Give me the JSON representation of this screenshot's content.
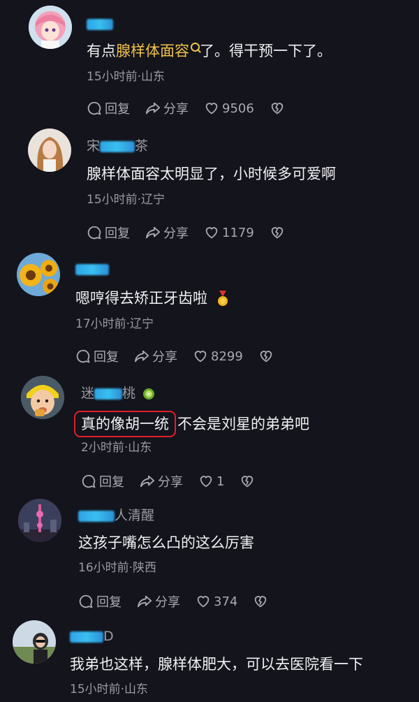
{
  "actions": {
    "reply_label": "回复",
    "share_label": "分享"
  },
  "comments": [
    {
      "username_suffix": "",
      "text_before": "有点",
      "text_highlight": "腺样体面容",
      "text_after": "了。得干预一下了。",
      "meta": "15小时前·山东",
      "likes": "9506"
    },
    {
      "username_prefix": "宋",
      "username_suffix": "茶",
      "text": "腺样体面容太明显了，小时候多可爱啊",
      "meta": "15小时前·辽宁",
      "likes": "1179"
    },
    {
      "username_suffix": "",
      "text": "嗯哼得去矫正牙齿啦",
      "meta": "17小时前·辽宁",
      "likes": "8299"
    },
    {
      "username_prefix": "迷",
      "username_suffix": "桃",
      "text_circled": "真的像胡一统",
      "text_after": "不会是刘星的弟弟吧",
      "meta": "2小时前·山东",
      "likes": "1"
    },
    {
      "username_suffix": "人清醒",
      "text": "这孩子嘴怎么凸的这么厉害",
      "meta": "16小时前·陕西",
      "likes": "374"
    },
    {
      "username_suffix": "D",
      "text": "我弟也这样，腺样体肥大，可以去医院看一下",
      "meta": "15小时前·山东"
    }
  ]
}
